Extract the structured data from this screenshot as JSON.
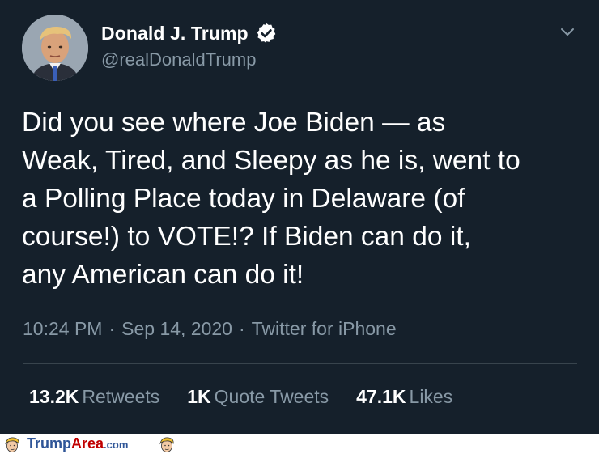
{
  "author": {
    "name": "Donald J. Trump",
    "handle": "@realDonaldTrump",
    "verified": true
  },
  "tweet": {
    "text": "Did you see where Joe Biden — as\nWeak, Tired, and Sleepy as he is, went to\na Polling Place today in Delaware (of\ncourse!) to VOTE!? If Biden can do it,\nany American can do it!",
    "time": "10:24 PM",
    "date": "Sep 14, 2020",
    "source": "Twitter for iPhone",
    "separator": "·"
  },
  "stats": {
    "retweets_count": "13.2K",
    "retweets_label": "Retweets",
    "quotes_count": "1K",
    "quotes_label": "Quote Tweets",
    "likes_count": "47.1K",
    "likes_label": "Likes"
  },
  "watermark": {
    "part1": "Trump",
    "part2": "Area",
    "part3": ".com"
  },
  "colors": {
    "background": "#15202b",
    "text": "#ffffff",
    "secondary": "#8899a6",
    "divider": "#38444d",
    "brand_blue": "#2f5597",
    "brand_red": "#c00000"
  },
  "icons": [
    "verified-badge-icon",
    "chevron-down-icon",
    "trump-face-icon"
  ]
}
